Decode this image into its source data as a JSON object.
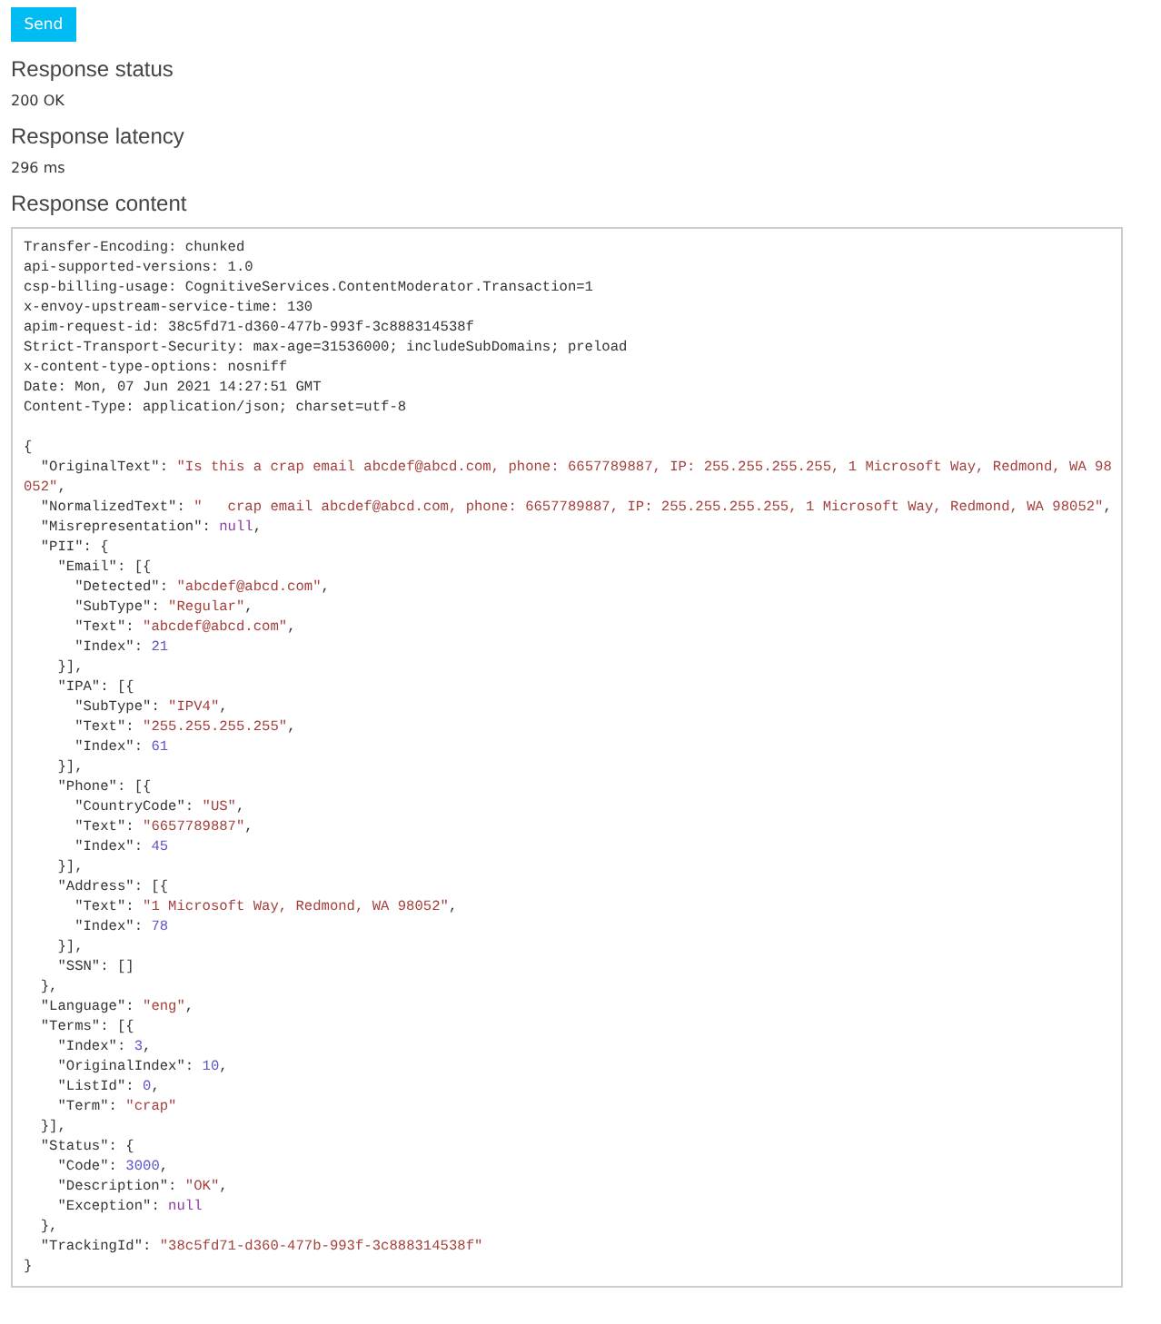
{
  "send_button": {
    "label": "Send"
  },
  "sections": [
    {
      "label": "Response status",
      "value": "200 OK"
    },
    {
      "label": "Response latency",
      "value": "296 ms"
    }
  ],
  "content": {
    "label": "Response content",
    "headers": [
      "Transfer-Encoding: chunked",
      "api-supported-versions: 1.0",
      "csp-billing-usage: CognitiveServices.ContentModerator.Transaction=1",
      "x-envoy-upstream-service-time: 130",
      "apim-request-id: 38c5fd71-d360-477b-993f-3c888314538f",
      "Strict-Transport-Security: max-age=31536000; includeSubDomains; preload",
      "x-content-type-options: nosniff",
      "Date: Mon, 07 Jun 2021 14:27:51 GMT",
      "Content-Type: application/json; charset=utf-8"
    ],
    "body": [
      [
        {
          "kind": "plain",
          "text": "{"
        }
      ],
      [
        {
          "kind": "key",
          "text": "  \"OriginalText\""
        },
        {
          "kind": "plain",
          "text": ": "
        },
        {
          "kind": "string",
          "text": "\"Is this a crap email abcdef@abcd.com, phone: 6657789887, IP: 255.255.255.255, 1 Microsoft Way, Redmond, WA 98"
        }
      ],
      [
        {
          "kind": "string",
          "text": "052\""
        },
        {
          "kind": "plain",
          "text": ","
        }
      ],
      [
        {
          "kind": "key",
          "text": "  \"NormalizedText\""
        },
        {
          "kind": "plain",
          "text": ": "
        },
        {
          "kind": "string",
          "text": "\"   crap email abcdef@abcd.com, phone: 6657789887, IP: 255.255.255.255, 1 Microsoft Way, Redmond, WA 98052\""
        },
        {
          "kind": "plain",
          "text": ","
        }
      ],
      [
        {
          "kind": "key",
          "text": "  \"Misrepresentation\""
        },
        {
          "kind": "plain",
          "text": ": "
        },
        {
          "kind": "literal",
          "text": "null"
        },
        {
          "kind": "plain",
          "text": ","
        }
      ],
      [
        {
          "kind": "key",
          "text": "  \"PII\""
        },
        {
          "kind": "plain",
          "text": ": {"
        }
      ],
      [
        {
          "kind": "key",
          "text": "    \"Email\""
        },
        {
          "kind": "plain",
          "text": ": [{"
        }
      ],
      [
        {
          "kind": "key",
          "text": "      \"Detected\""
        },
        {
          "kind": "plain",
          "text": ": "
        },
        {
          "kind": "string",
          "text": "\"abcdef@abcd.com\""
        },
        {
          "kind": "plain",
          "text": ","
        }
      ],
      [
        {
          "kind": "key",
          "text": "      \"SubType\""
        },
        {
          "kind": "plain",
          "text": ": "
        },
        {
          "kind": "string",
          "text": "\"Regular\""
        },
        {
          "kind": "plain",
          "text": ","
        }
      ],
      [
        {
          "kind": "key",
          "text": "      \"Text\""
        },
        {
          "kind": "plain",
          "text": ": "
        },
        {
          "kind": "string",
          "text": "\"abcdef@abcd.com\""
        },
        {
          "kind": "plain",
          "text": ","
        }
      ],
      [
        {
          "kind": "key",
          "text": "      \"Index\""
        },
        {
          "kind": "plain",
          "text": ": "
        },
        {
          "kind": "number",
          "text": "21"
        }
      ],
      [
        {
          "kind": "plain",
          "text": "    }],"
        }
      ],
      [
        {
          "kind": "key",
          "text": "    \"IPA\""
        },
        {
          "kind": "plain",
          "text": ": [{"
        }
      ],
      [
        {
          "kind": "key",
          "text": "      \"SubType\""
        },
        {
          "kind": "plain",
          "text": ": "
        },
        {
          "kind": "string",
          "text": "\"IPV4\""
        },
        {
          "kind": "plain",
          "text": ","
        }
      ],
      [
        {
          "kind": "key",
          "text": "      \"Text\""
        },
        {
          "kind": "plain",
          "text": ": "
        },
        {
          "kind": "string",
          "text": "\"255.255.255.255\""
        },
        {
          "kind": "plain",
          "text": ","
        }
      ],
      [
        {
          "kind": "key",
          "text": "      \"Index\""
        },
        {
          "kind": "plain",
          "text": ": "
        },
        {
          "kind": "number",
          "text": "61"
        }
      ],
      [
        {
          "kind": "plain",
          "text": "    }],"
        }
      ],
      [
        {
          "kind": "key",
          "text": "    \"Phone\""
        },
        {
          "kind": "plain",
          "text": ": [{"
        }
      ],
      [
        {
          "kind": "key",
          "text": "      \"CountryCode\""
        },
        {
          "kind": "plain",
          "text": ": "
        },
        {
          "kind": "string",
          "text": "\"US\""
        },
        {
          "kind": "plain",
          "text": ","
        }
      ],
      [
        {
          "kind": "key",
          "text": "      \"Text\""
        },
        {
          "kind": "plain",
          "text": ": "
        },
        {
          "kind": "string",
          "text": "\"6657789887\""
        },
        {
          "kind": "plain",
          "text": ","
        }
      ],
      [
        {
          "kind": "key",
          "text": "      \"Index\""
        },
        {
          "kind": "plain",
          "text": ": "
        },
        {
          "kind": "number",
          "text": "45"
        }
      ],
      [
        {
          "kind": "plain",
          "text": "    }],"
        }
      ],
      [
        {
          "kind": "key",
          "text": "    \"Address\""
        },
        {
          "kind": "plain",
          "text": ": [{"
        }
      ],
      [
        {
          "kind": "key",
          "text": "      \"Text\""
        },
        {
          "kind": "plain",
          "text": ": "
        },
        {
          "kind": "string",
          "text": "\"1 Microsoft Way, Redmond, WA 98052\""
        },
        {
          "kind": "plain",
          "text": ","
        }
      ],
      [
        {
          "kind": "key",
          "text": "      \"Index\""
        },
        {
          "kind": "plain",
          "text": ": "
        },
        {
          "kind": "number",
          "text": "78"
        }
      ],
      [
        {
          "kind": "plain",
          "text": "    }],"
        }
      ],
      [
        {
          "kind": "key",
          "text": "    \"SSN\""
        },
        {
          "kind": "plain",
          "text": ": []"
        }
      ],
      [
        {
          "kind": "plain",
          "text": "  },"
        }
      ],
      [
        {
          "kind": "key",
          "text": "  \"Language\""
        },
        {
          "kind": "plain",
          "text": ": "
        },
        {
          "kind": "string",
          "text": "\"eng\""
        },
        {
          "kind": "plain",
          "text": ","
        }
      ],
      [
        {
          "kind": "key",
          "text": "  \"Terms\""
        },
        {
          "kind": "plain",
          "text": ": [{"
        }
      ],
      [
        {
          "kind": "key",
          "text": "    \"Index\""
        },
        {
          "kind": "plain",
          "text": ": "
        },
        {
          "kind": "number",
          "text": "3"
        },
        {
          "kind": "plain",
          "text": ","
        }
      ],
      [
        {
          "kind": "key",
          "text": "    \"OriginalIndex\""
        },
        {
          "kind": "plain",
          "text": ": "
        },
        {
          "kind": "number",
          "text": "10"
        },
        {
          "kind": "plain",
          "text": ","
        }
      ],
      [
        {
          "kind": "key",
          "text": "    \"ListId\""
        },
        {
          "kind": "plain",
          "text": ": "
        },
        {
          "kind": "number",
          "text": "0"
        },
        {
          "kind": "plain",
          "text": ","
        }
      ],
      [
        {
          "kind": "key",
          "text": "    \"Term\""
        },
        {
          "kind": "plain",
          "text": ": "
        },
        {
          "kind": "string",
          "text": "\"crap\""
        }
      ],
      [
        {
          "kind": "plain",
          "text": "  }],"
        }
      ],
      [
        {
          "kind": "key",
          "text": "  \"Status\""
        },
        {
          "kind": "plain",
          "text": ": {"
        }
      ],
      [
        {
          "kind": "key",
          "text": "    \"Code\""
        },
        {
          "kind": "plain",
          "text": ": "
        },
        {
          "kind": "number",
          "text": "3000"
        },
        {
          "kind": "plain",
          "text": ","
        }
      ],
      [
        {
          "kind": "key",
          "text": "    \"Description\""
        },
        {
          "kind": "plain",
          "text": ": "
        },
        {
          "kind": "string",
          "text": "\"OK\""
        },
        {
          "kind": "plain",
          "text": ","
        }
      ],
      [
        {
          "kind": "key",
          "text": "    \"Exception\""
        },
        {
          "kind": "plain",
          "text": ": "
        },
        {
          "kind": "literal",
          "text": "null"
        }
      ],
      [
        {
          "kind": "plain",
          "text": "  },"
        }
      ],
      [
        {
          "kind": "key",
          "text": "  \"TrackingId\""
        },
        {
          "kind": "plain",
          "text": ": "
        },
        {
          "kind": "string",
          "text": "\"38c5fd71-d360-477b-993f-3c888314538f\""
        }
      ],
      [
        {
          "kind": "plain",
          "text": "}"
        }
      ]
    ]
  }
}
